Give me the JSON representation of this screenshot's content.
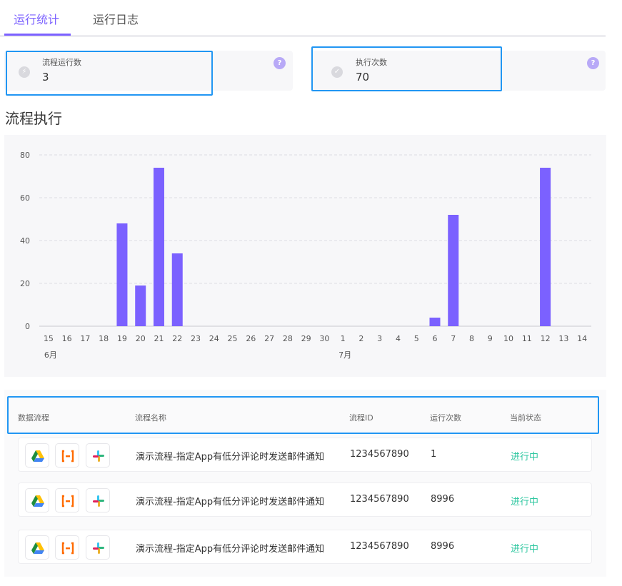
{
  "tabs": [
    {
      "label": "运行统计",
      "active": true
    },
    {
      "label": "运行日志",
      "active": false
    }
  ],
  "stats": [
    {
      "label": "流程运行数",
      "value": "3",
      "icon": "bolt-icon"
    },
    {
      "label": "执行次数",
      "value": "70",
      "icon": "check-circle-icon"
    }
  ],
  "help_glyph": "?",
  "section_title": "流程执行",
  "chart_data": {
    "type": "bar",
    "categories": [
      "15",
      "16",
      "17",
      "18",
      "19",
      "20",
      "21",
      "22",
      "23",
      "24",
      "25",
      "26",
      "27",
      "28",
      "29",
      "30",
      "1",
      "2",
      "3",
      "4",
      "5",
      "6",
      "7",
      "8",
      "9",
      "10",
      "11",
      "12",
      "13",
      "14"
    ],
    "values": [
      0,
      0,
      0,
      0,
      48,
      19,
      74,
      34,
      0,
      0,
      0,
      0,
      0,
      0,
      0,
      0,
      0,
      0,
      0,
      0,
      0,
      4,
      52,
      0,
      0,
      0,
      0,
      74,
      0,
      0
    ],
    "month_labels": [
      {
        "label": "6月",
        "at_category": 0
      },
      {
        "label": "7月",
        "at_category": 16
      }
    ],
    "y_ticks": [
      0,
      20,
      40,
      60,
      80
    ],
    "ylim": [
      0,
      80
    ],
    "bar_color": "#7b61ff",
    "grid": true
  },
  "table": {
    "headers": [
      "数据流程",
      "流程名称",
      "流程ID",
      "运行次数",
      "当前状态"
    ],
    "rows": [
      {
        "apps": [
          "google-drive-icon",
          "bracket-app-icon",
          "slack-icon"
        ],
        "name": "演示流程-指定App有低分评论时发送邮件通知",
        "id": "1234567890",
        "runs": "1",
        "status": "进行中"
      },
      {
        "apps": [
          "google-drive-icon",
          "bracket-app-icon",
          "slack-icon"
        ],
        "name": "演示流程-指定App有低分评论时发送邮件通知",
        "id": "1234567890",
        "runs": "8996",
        "status": "进行中"
      },
      {
        "apps": [
          "google-drive-icon",
          "bracket-app-icon",
          "slack-icon"
        ],
        "name": "演示流程-指定App有低分评论时发送邮件通知",
        "id": "1234567890",
        "runs": "8996",
        "status": "进行中"
      }
    ]
  },
  "colors": {
    "accent": "#7b61ff",
    "status_running": "#2ec7a0",
    "highlight": "#2196f3"
  }
}
